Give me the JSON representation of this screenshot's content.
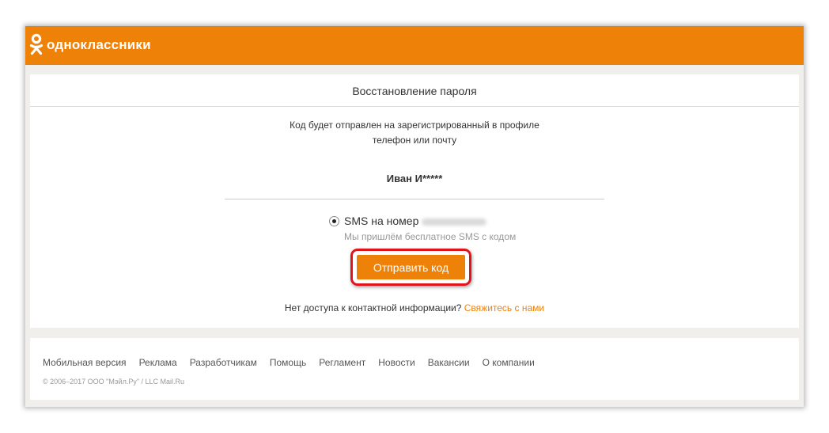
{
  "header": {
    "logo_text": "одноклассники",
    "brand_color": "#ee8208",
    "logo_icon": "ok-logo-icon"
  },
  "recovery": {
    "title": "Восстановление пароля",
    "info_line1": "Код будет отправлен на зарегистрированный в профиле",
    "info_line2": "телефон или почту",
    "user_name": "Иван И*****",
    "sms_label": "SMS на номер",
    "sms_selected": true,
    "sms_hint": "Мы пришлём бесплатное SMS с кодом",
    "send_button": "Отправить код",
    "highlight_color": "#e1141c",
    "no_access_text": "Нет доступа к контактной информации?",
    "contact_link": "Свяжитесь с нами"
  },
  "footer": {
    "links": [
      {
        "label": "Мобильная версия"
      },
      {
        "label": "Реклама"
      },
      {
        "label": "Разработчикам"
      },
      {
        "label": "Помощь"
      },
      {
        "label": "Регламент"
      },
      {
        "label": "Новости"
      },
      {
        "label": "Вакансии"
      },
      {
        "label": "О компании"
      }
    ],
    "copyright": "© 2006–2017 ООО \"Мэйл.Ру\" / LLC Mail.Ru"
  }
}
